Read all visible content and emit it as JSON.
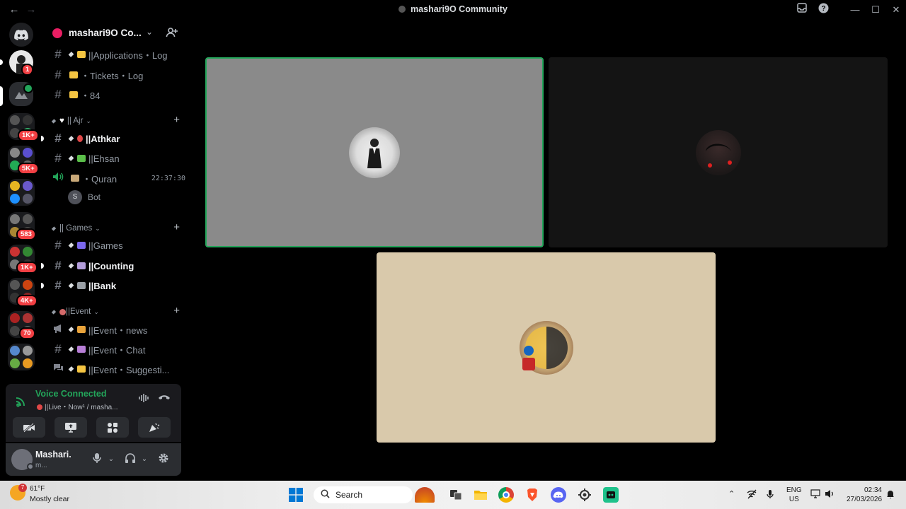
{
  "window": {
    "title": "mashari9O Community",
    "back_icon": "←",
    "forward_icon": "→",
    "inbox_icon": "inbox-icon",
    "help_icon": "?",
    "minimize": "—",
    "maximize": "☐",
    "close": "✕"
  },
  "rail": {
    "badges": [
      "1",
      "1K+",
      "5K+",
      "583",
      "1K+",
      "4K+",
      "70"
    ]
  },
  "guild": {
    "name": "mashari9O Co...",
    "chevron": "⌄"
  },
  "channels": {
    "top": [
      {
        "name": "||Applications・Log"
      },
      {
        "name": "・Tickets・Log"
      },
      {
        "name": "・84"
      }
    ],
    "category_ajr": {
      "label": "|| Ajr",
      "items": [
        {
          "name": "||Athkar"
        },
        {
          "name": "||Ehsan"
        },
        {
          "name": "・Quran",
          "time": "22:37:30"
        }
      ],
      "bot": {
        "name": "Bot",
        "initial": "S"
      }
    },
    "category_games": {
      "label": "|| Games",
      "items": [
        {
          "name": "||Games"
        },
        {
          "name": "||Counting"
        },
        {
          "name": "||Bank"
        }
      ]
    },
    "category_event": {
      "label": "||Event",
      "items": [
        {
          "name": "||Event・news"
        },
        {
          "name": "||Event・Chat"
        },
        {
          "name": "||Event・Suggesti..."
        }
      ]
    }
  },
  "voice": {
    "status": "Voice Connected",
    "sub": "||Live・Now¹ / masha..."
  },
  "user": {
    "name": "Mashari.",
    "sub": "m..."
  },
  "taskbar": {
    "temp": "61°F",
    "weather": "Mostly clear",
    "weather_badge": "7",
    "search": "Search",
    "lang_top": "ENG",
    "lang_bottom": "US",
    "time": "02:34",
    "date": "27/03/2026"
  },
  "colors": {
    "speaking_border": "#23a55a",
    "voice_connected": "#23a55a",
    "badge": "#f23f43"
  }
}
